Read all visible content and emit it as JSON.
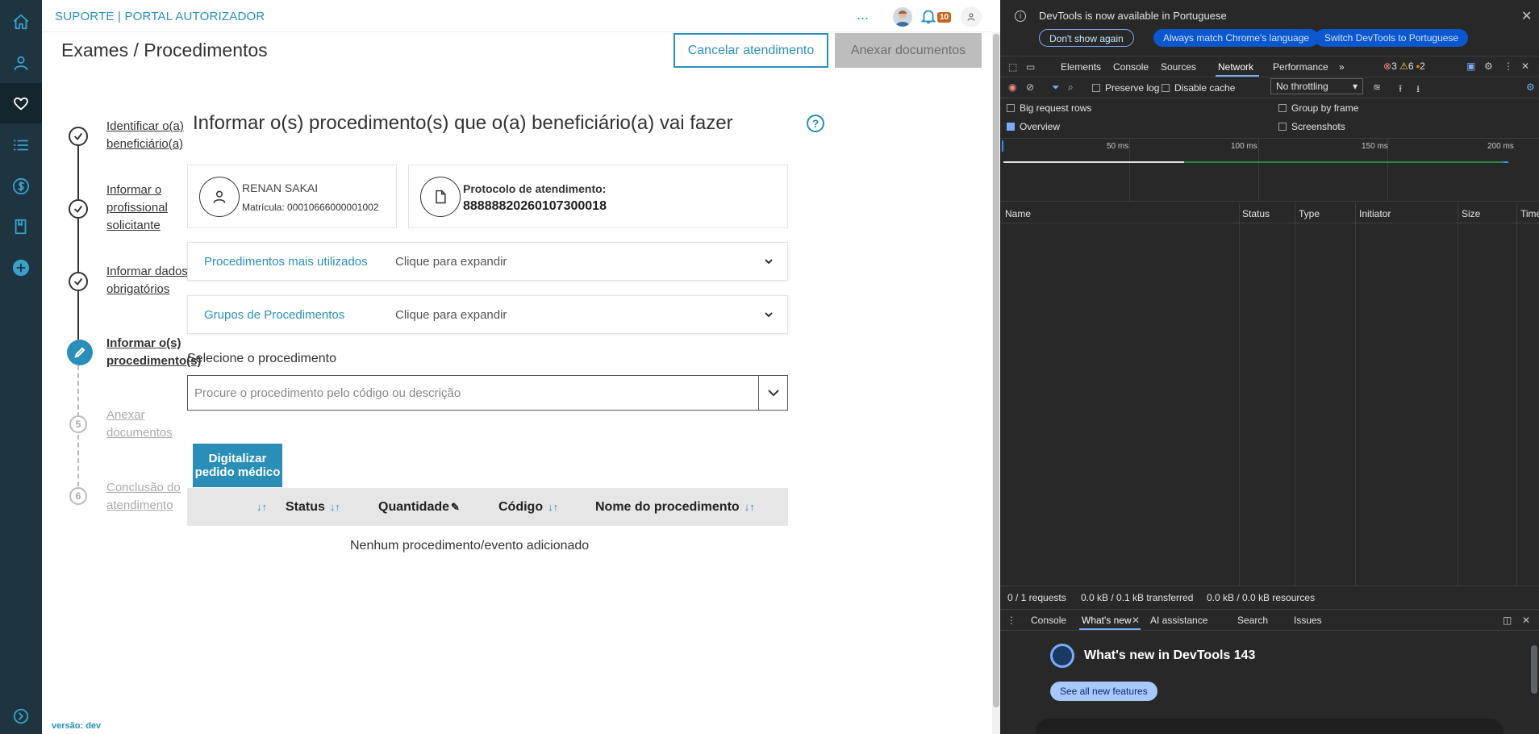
{
  "app": {
    "brand": "SUPORTE | PORTAL AUTORIZADOR",
    "version": "versão: dev",
    "notification_count": "10",
    "more": "..."
  },
  "nav": {
    "items": [
      "home-icon",
      "user-icon",
      "heart-icon",
      "list-icon",
      "dollar-icon",
      "book-icon",
      "plus-circle-icon"
    ],
    "active": "heart-icon",
    "expand_icon": "chevron-right-circle-icon"
  },
  "page": {
    "title": "Exames / Procedimentos",
    "cancel_label": "Cancelar atendimento",
    "attach_label": "Anexar documentos"
  },
  "steps": [
    {
      "label": "Identificar o(a) beneficiário(a)",
      "state": "done"
    },
    {
      "label": "Informar o profissional solicitante",
      "state": "done"
    },
    {
      "label": "Informar dados obrigatórios",
      "state": "done"
    },
    {
      "label": "Informar o(s) procedimento(s)",
      "state": "current"
    },
    {
      "label": "Anexar documentos",
      "state": "pending",
      "number": "5"
    },
    {
      "label": "Conclusão do atendimento",
      "state": "pending",
      "number": "6"
    }
  ],
  "section": {
    "title": "Informar o(s) procedimento(s) que o(a) beneficiário(a) vai fazer",
    "help": "?"
  },
  "beneficiary": {
    "name": "RENAN SAKAI",
    "registration": "Matrícula: 00010666000001002"
  },
  "protocol": {
    "label": "Protocolo de atendimento:",
    "value": "88888820260107300018"
  },
  "accordions": [
    {
      "title": "Procedimentos mais utilizados",
      "hint": "Clique para expandir"
    },
    {
      "title": "Grupos de Procedimentos",
      "hint": "Clique para expandir"
    }
  ],
  "procedure_select": {
    "label": "Selecione o procedimento",
    "placeholder": "Procure o procedimento pelo código ou descrição"
  },
  "scan_button": "Digitalizar pedido médico",
  "table": {
    "columns": [
      "",
      "Status",
      "Quantidade",
      "Código",
      "Nome do procedimento"
    ],
    "sort_glyph": "↓↑",
    "empty": "Nenhum procedimento/evento adicionado"
  },
  "devtools": {
    "info": "DevTools is now available in Portuguese",
    "buttons": [
      "Don't show again",
      "Always match Chrome's language",
      "Switch DevTools to Portuguese"
    ],
    "tabs": [
      "Elements",
      "Console",
      "Sources",
      "Network",
      "Performance"
    ],
    "active_tab": "Network",
    "more_tabs": "»",
    "errors": "3",
    "warnings": "6",
    "messages": "2",
    "preserve_log": "Preserve log",
    "disable_cache": "Disable cache",
    "throttling": "No throttling",
    "options": [
      {
        "label": "Big request rows",
        "checked": false
      },
      {
        "label": "Group by frame",
        "checked": false
      },
      {
        "label": "Overview",
        "checked": true
      },
      {
        "label": "Screenshots",
        "checked": false
      }
    ],
    "ticks": [
      "50 ms",
      "100 ms",
      "150 ms",
      "200 ms"
    ],
    "columns": [
      "Name",
      "Status",
      "Type",
      "Initiator",
      "Size",
      "Time"
    ],
    "status_bar": [
      "0 / 1 requests",
      "0.0 kB / 0.1 kB transferred",
      "0.0 kB / 0.0 kB resources"
    ],
    "drawer_tabs": [
      "Console",
      "What's new",
      "AI assistance",
      "Search",
      "Issues"
    ],
    "drawer_active": "What's new",
    "whatsnew_title": "What's new in DevTools 143",
    "see_all": "See all new features"
  }
}
